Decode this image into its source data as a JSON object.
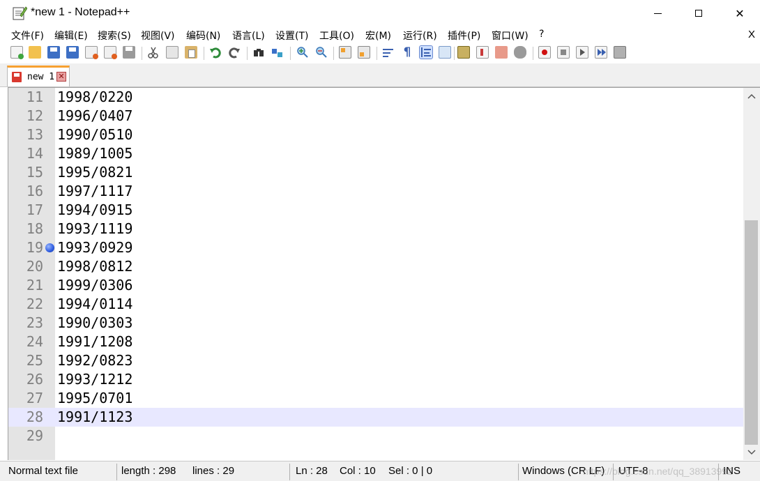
{
  "window": {
    "title": "*new 1 - Notepad++",
    "close_glyph": "✕"
  },
  "menu": {
    "items": [
      "文件(F)",
      "编辑(E)",
      "搜索(S)",
      "视图(V)",
      "编码(N)",
      "语言(L)",
      "设置(T)",
      "工具(O)",
      "宏(M)",
      "运行(R)",
      "插件(P)",
      "窗口(W)",
      "?"
    ],
    "close_label": "X"
  },
  "toolbar": {
    "icons": [
      "new-file-icon",
      "open-file-icon",
      "save-icon",
      "save-all-icon",
      "close-icon",
      "close-all-icon",
      "print-icon",
      "cut-icon",
      "copy-icon",
      "paste-icon",
      "undo-icon",
      "redo-icon",
      "find-icon",
      "replace-icon",
      "zoom-in-icon",
      "zoom-out-icon",
      "sync-vertical-icon",
      "sync-horizontal-icon",
      "word-wrap-icon",
      "show-all-chars-icon",
      "indent-guide-icon",
      "doc-map-icon",
      "function-list-icon",
      "folder-workspace-icon",
      "monitoring-icon",
      "record-macro-icon",
      "stop-macro-icon",
      "play-macro-icon",
      "run-macro-multiple-icon",
      "save-macro-icon"
    ]
  },
  "tabs": [
    {
      "label": "new 1",
      "close_glyph": "✕"
    }
  ],
  "editor": {
    "lines": [
      {
        "no": "11",
        "text": "1998/0220"
      },
      {
        "no": "12",
        "text": "1996/0407"
      },
      {
        "no": "13",
        "text": "1990/0510"
      },
      {
        "no": "14",
        "text": "1989/1005"
      },
      {
        "no": "15",
        "text": "1995/0821"
      },
      {
        "no": "16",
        "text": "1997/1117"
      },
      {
        "no": "17",
        "text": "1994/0915"
      },
      {
        "no": "18",
        "text": "1993/1119"
      },
      {
        "no": "19",
        "text": "1993/0929",
        "bookmark": true
      },
      {
        "no": "20",
        "text": "1998/0812"
      },
      {
        "no": "21",
        "text": "1999/0306"
      },
      {
        "no": "22",
        "text": "1994/0114"
      },
      {
        "no": "23",
        "text": "1990/0303"
      },
      {
        "no": "24",
        "text": "1991/1208"
      },
      {
        "no": "25",
        "text": "1992/0823"
      },
      {
        "no": "26",
        "text": "1993/1212"
      },
      {
        "no": "27",
        "text": "1995/0701"
      },
      {
        "no": "28",
        "text": "1991/1123",
        "current": true
      },
      {
        "no": "29",
        "text": ""
      }
    ],
    "current_line_color": "#e8e8ff",
    "gutter_color": "#e4e4e4"
  },
  "status": {
    "file_type": "Normal text file",
    "length": "length : 298",
    "lines": "lines : 29",
    "ln": "Ln : 28",
    "col": "Col : 10",
    "sel": "Sel : 0 | 0",
    "eol": "Windows (CR LF)",
    "encoding": "UTF-8",
    "mode": "INS",
    "watermark": "https://blog.csdn.net/qq_38913992"
  }
}
